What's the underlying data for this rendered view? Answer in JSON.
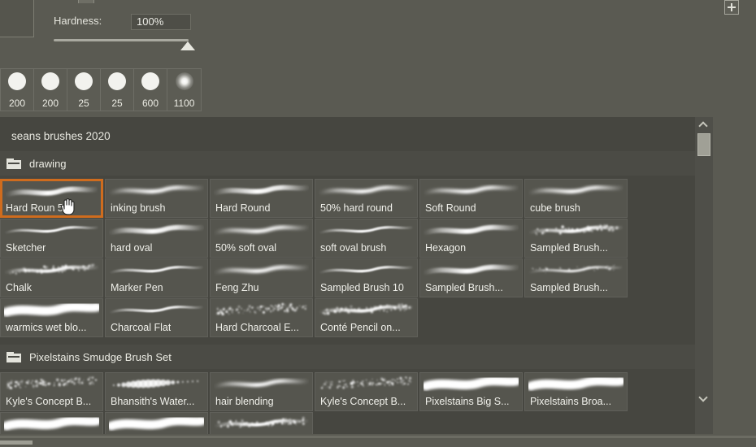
{
  "window": {
    "app_theme_bg": "#5a5a52",
    "panel_bg": "#464640",
    "accent_selected": "#cf6c1e"
  },
  "toolbar": {
    "hardness_label": "Hardness:",
    "hardness_value": "100%",
    "hardness_slider_percent": 100,
    "add_button_icon": "plus-icon",
    "curve_widget_icon": "curve-graph-icon",
    "play_icon": "play-triangle-icon"
  },
  "brush_tips": {
    "items": [
      {
        "size": "200",
        "kind": "hard"
      },
      {
        "size": "200",
        "kind": "hard"
      },
      {
        "size": "25",
        "kind": "hard"
      },
      {
        "size": "25",
        "kind": "hard"
      },
      {
        "size": "600",
        "kind": "hard"
      },
      {
        "size": "1100",
        "kind": "soft"
      }
    ]
  },
  "library": {
    "title": "seans brushes 2020",
    "scrollbar": {
      "up_icon": "chevron-up-icon",
      "down_icon": "chevron-down-icon"
    },
    "groups": [
      {
        "name": "drawing",
        "folder_icon": "folder-icon",
        "rows": [
          [
            {
              "label": "Hard Roun 5 1",
              "selected": true,
              "stroke": "tapered-hard"
            },
            {
              "label": "inking brush",
              "selected": false,
              "stroke": "tapered-soft"
            },
            {
              "label": "Hard Round",
              "selected": false,
              "stroke": "tapered-hard"
            },
            {
              "label": "50% hard round",
              "selected": false,
              "stroke": "tapered-soft"
            },
            {
              "label": "Soft Round",
              "selected": false,
              "stroke": "tapered-soft"
            },
            {
              "label": "cube brush",
              "selected": false,
              "stroke": "tapered-soft"
            }
          ],
          [
            {
              "label": "Sketcher",
              "selected": false,
              "stroke": "thin-taper"
            },
            {
              "label": "hard oval",
              "selected": false,
              "stroke": "tapered-hard"
            },
            {
              "label": "50% soft oval",
              "selected": false,
              "stroke": "tapered-soft"
            },
            {
              "label": "soft oval brush",
              "selected": false,
              "stroke": "thin-taper"
            },
            {
              "label": "Hexagon",
              "selected": false,
              "stroke": "tapered-hard"
            },
            {
              "label": "Sampled Brush...",
              "selected": false,
              "stroke": "grainy"
            }
          ],
          [
            {
              "label": "Chalk",
              "selected": false,
              "stroke": "grainy"
            },
            {
              "label": "Marker Pen",
              "selected": false,
              "stroke": "thin-taper"
            },
            {
              "label": "Feng Zhu",
              "selected": false,
              "stroke": "tapered-soft"
            },
            {
              "label": "Sampled Brush 10",
              "selected": false,
              "stroke": "thin-taper"
            },
            {
              "label": "Sampled Brush...",
              "selected": false,
              "stroke": "tapered-hard"
            },
            {
              "label": "Sampled Brush...",
              "selected": false,
              "stroke": "speckled"
            }
          ],
          [
            {
              "label": "warmics wet blo...",
              "selected": false,
              "stroke": "broad-soft"
            },
            {
              "label": "Charcoal Flat",
              "selected": false,
              "stroke": "thin-taper"
            },
            {
              "label": "Hard Charcoal E...",
              "selected": false,
              "stroke": "scatter"
            },
            {
              "label": "Conté Pencil on...",
              "selected": false,
              "stroke": "grainy"
            }
          ]
        ]
      },
      {
        "name": "Pixelstains Smudge Brush Set",
        "folder_icon": "folder-icon",
        "rows": [
          [
            {
              "label": "Kyle's Concept B...",
              "selected": false,
              "stroke": "scatter"
            },
            {
              "label": "Bhansith's Water...",
              "selected": false,
              "stroke": "dots"
            },
            {
              "label": "hair blending",
              "selected": false,
              "stroke": "tapered-soft"
            },
            {
              "label": "Kyle's Concept B...",
              "selected": false,
              "stroke": "scatter"
            },
            {
              "label": "Pixelstains Big S...",
              "selected": false,
              "stroke": "broad-soft"
            },
            {
              "label": "Pixelstains Broa...",
              "selected": false,
              "stroke": "broad-soft"
            }
          ],
          [
            {
              "label": "",
              "selected": false,
              "stroke": "broad-soft"
            },
            {
              "label": "",
              "selected": false,
              "stroke": "broad-soft"
            },
            {
              "label": "",
              "selected": false,
              "stroke": "grainy"
            }
          ]
        ]
      }
    ]
  }
}
